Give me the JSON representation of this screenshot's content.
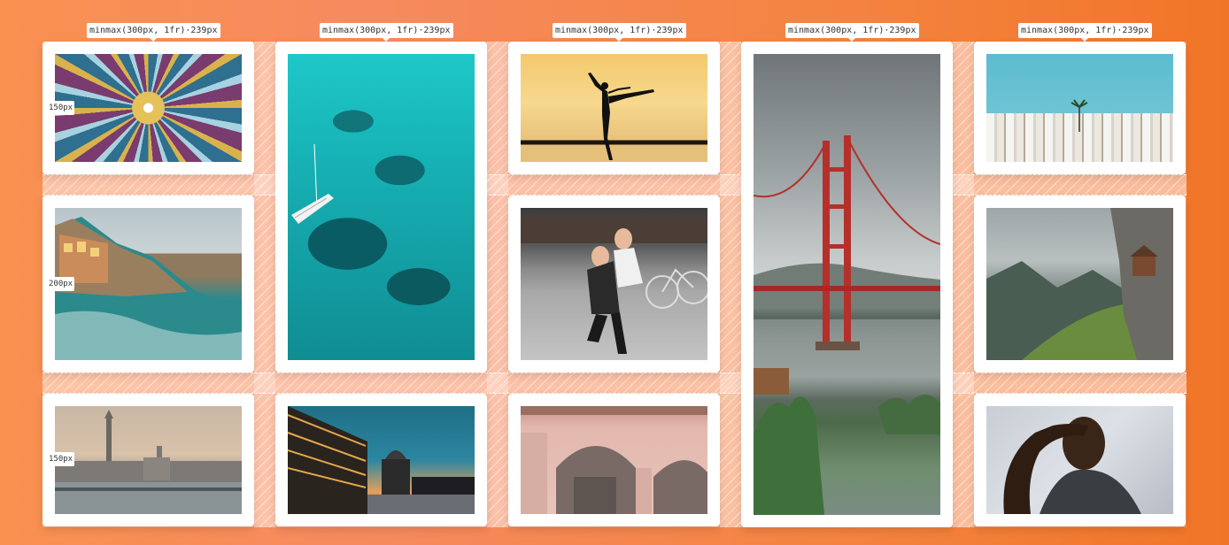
{
  "grid": {
    "column_track_label": "minmax(300px, 1fr)·239px",
    "row_track_labels": [
      "150px",
      "200px",
      "150px"
    ]
  },
  "items": [
    {
      "name": "tile-mosaic-photo",
      "subject": "islamic geometric tile mosaic",
      "span": "1x1"
    },
    {
      "name": "ocean-sailboat-photo",
      "subject": "aerial turquoise ocean with sailboat",
      "span": "1x2"
    },
    {
      "name": "dancer-silhouette-photo",
      "subject": "dancer silhouette at sunset",
      "span": "1x1"
    },
    {
      "name": "golden-gate-bridge-photo",
      "subject": "golden gate bridge under clouds",
      "span": "1x3"
    },
    {
      "name": "white-village-photo",
      "subject": "white hillside village with palm tree",
      "span": "1x1"
    },
    {
      "name": "coastal-village-photo",
      "subject": "cliffside coastal village",
      "span": "1x1"
    },
    {
      "name": "friends-piggyback-photo",
      "subject": "two friends piggyback on street",
      "span": "1x1"
    },
    {
      "name": "mountain-valley-photo",
      "subject": "misty mountain valley with cliff house",
      "span": "1x1"
    },
    {
      "name": "city-skyline-photo",
      "subject": "city skyline with tower by river",
      "span": "1x1"
    },
    {
      "name": "night-building-photo",
      "subject": "lit building and dome at dusk",
      "span": "1x1"
    },
    {
      "name": "pink-arches-photo",
      "subject": "pink arched building facade",
      "span": "1x1"
    },
    {
      "name": "portrait-photo",
      "subject": "man portrait in grey t-shirt",
      "span": "1x1"
    }
  ],
  "colors": {
    "background_start": "#f99150",
    "background_end": "#f17528",
    "gap_overlay": "#ffdccd",
    "card": "#ffffff"
  }
}
